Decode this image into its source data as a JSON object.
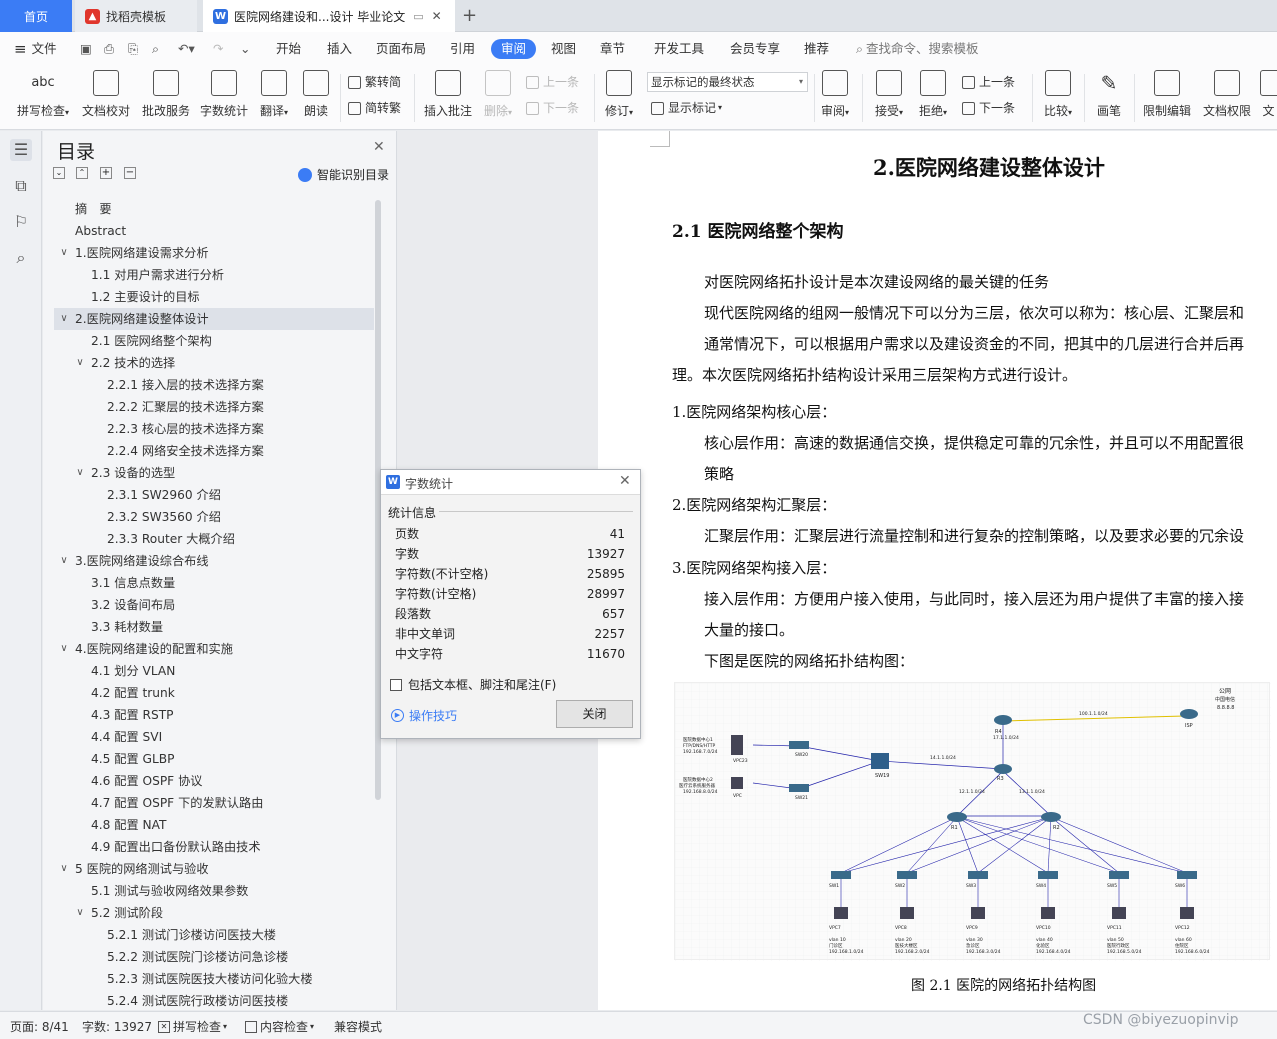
{
  "tabs": {
    "home": "首页",
    "templates": "找稻壳模板",
    "document": "医院网络建设和...设计 毕业论文"
  },
  "menu": {
    "file": "文件",
    "items": [
      "开始",
      "插入",
      "页面布局",
      "引用",
      "审阅",
      "视图",
      "章节",
      "开发工具",
      "会员专享",
      "推荐"
    ],
    "active": "审阅",
    "search_placeholder": "查找命令、搜索模板"
  },
  "ribbon": {
    "spell_check": "拼写检查",
    "doc_proof": "文档校对",
    "batch_service": "批改服务",
    "word_count": "字数统计",
    "translate": "翻译",
    "read_aloud": "朗读",
    "trad_simp": "繁转简",
    "simp_trad": "简转繁",
    "insert_comment": "插入批注",
    "delete": "删除",
    "prev1": "上一条",
    "next1": "下一条",
    "revise": "修订",
    "markup_state": "显示标记的最终状态",
    "show_markup": "显示标记",
    "review": "审阅",
    "accept": "接受",
    "reject": "拒绝",
    "prev2": "上一条",
    "next2": "下一条",
    "compare": "比较",
    "pen": "画笔",
    "restrict_edit": "限制编辑",
    "doc_permission": "文档权限",
    "doc_cut": "文"
  },
  "nav": {
    "title": "目录",
    "smart_toc": "智能识别目录",
    "items": [
      {
        "label": "摘　要",
        "level": 0,
        "chev": ""
      },
      {
        "label": "Abstract",
        "level": 0,
        "chev": ""
      },
      {
        "label": "1.医院网络建设需求分析",
        "level": 0,
        "chev": "∨"
      },
      {
        "label": "1.1 对用户需求进行分析",
        "level": 1,
        "chev": ""
      },
      {
        "label": "1.2 主要设计的目标",
        "level": 1,
        "chev": ""
      },
      {
        "label": "2.医院网络建设整体设计",
        "level": 0,
        "chev": "∨"
      },
      {
        "label": "2.1 医院网络整个架构",
        "level": 1,
        "chev": ""
      },
      {
        "label": "2.2 技术的选择",
        "level": 1,
        "chev": "∨"
      },
      {
        "label": "2.2.1  接入层的技术选择方案",
        "level": 2,
        "chev": ""
      },
      {
        "label": "2.2.2  汇聚层的技术选择方案",
        "level": 2,
        "chev": ""
      },
      {
        "label": "2.2.3  核心层的技术选择方案",
        "level": 2,
        "chev": ""
      },
      {
        "label": "2.2.4 网络安全技术选择方案",
        "level": 2,
        "chev": ""
      },
      {
        "label": "2.3 设备的选型",
        "level": 1,
        "chev": "∨"
      },
      {
        "label": "2.3.1 SW2960 介绍",
        "level": 2,
        "chev": ""
      },
      {
        "label": "2.3.2 SW3560 介绍",
        "level": 2,
        "chev": ""
      },
      {
        "label": "2.3.3 Router 大概介绍",
        "level": 2,
        "chev": ""
      },
      {
        "label": "3.医院网络建设综合布线",
        "level": 0,
        "chev": "∨"
      },
      {
        "label": "3.1  信息点数量",
        "level": 1,
        "chev": ""
      },
      {
        "label": "3.2  设备间布局",
        "level": 1,
        "chev": ""
      },
      {
        "label": "3.3  耗材数量",
        "level": 1,
        "chev": ""
      },
      {
        "label": "4.医院网络建设的配置和实施",
        "level": 0,
        "chev": "∨"
      },
      {
        "label": "4.1  划分 VLAN",
        "level": 1,
        "chev": ""
      },
      {
        "label": "4.2  配置 trunk",
        "level": 1,
        "chev": ""
      },
      {
        "label": "4.3  配置 RSTP",
        "level": 1,
        "chev": ""
      },
      {
        "label": "4.4  配置 SVI",
        "level": 1,
        "chev": ""
      },
      {
        "label": "4.5  配置 GLBP",
        "level": 1,
        "chev": ""
      },
      {
        "label": "4.6  配置 OSPF 协议",
        "level": 1,
        "chev": ""
      },
      {
        "label": "4.7 配置 OSPF 下的发默认路由",
        "level": 1,
        "chev": ""
      },
      {
        "label": "4.8 配置 NAT",
        "level": 1,
        "chev": ""
      },
      {
        "label": "4.9 配置出口备份默认路由技术",
        "level": 1,
        "chev": ""
      },
      {
        "label": "5 医院的网络测试与验收",
        "level": 0,
        "chev": "∨"
      },
      {
        "label": "5.1 测试与验收网络效果参数",
        "level": 1,
        "chev": ""
      },
      {
        "label": "5.2 测试阶段",
        "level": 1,
        "chev": "∨"
      },
      {
        "label": "5.2.1 测试门诊楼访问医技大楼",
        "level": 2,
        "chev": ""
      },
      {
        "label": "5.2.2 测试医院门诊楼访问急诊楼",
        "level": 2,
        "chev": ""
      },
      {
        "label": "5.2.3 测试医院医技大楼访问化验大楼",
        "level": 2,
        "chev": ""
      },
      {
        "label": "5.2.4 测试医院行政楼访问医技楼",
        "level": 2,
        "chev": ""
      }
    ],
    "selected_index": 5
  },
  "dialog": {
    "title": "字数统计",
    "section": "统计信息",
    "rows": [
      {
        "label": "页数",
        "value": "41"
      },
      {
        "label": "字数",
        "value": "13927"
      },
      {
        "label": "字符数(不计空格)",
        "value": "25895"
      },
      {
        "label": "字符数(计空格)",
        "value": "28997"
      },
      {
        "label": "段落数",
        "value": "657"
      },
      {
        "label": "非中文单词",
        "value": "2257"
      },
      {
        "label": "中文字符",
        "value": "11670"
      }
    ],
    "checkbox": "包括文本框、脚注和尾注(F)",
    "tips": "操作技巧",
    "close": "关闭"
  },
  "document": {
    "heading": "2.医院网络建设整体设计",
    "subheading": "2.1 医院网络整个架构",
    "lines": [
      "对医院网络拓扑设计是本次建设网络的最关键的任务",
      "现代医院网络的组网一般情况下可以分为三层，依次可以称为：核心层、汇聚层和",
      "通常情况下，可以根据用户需求以及建设资金的不同，把其中的几层进行合并后再",
      "理。本次医院网络拓扑结构设计采用三层架构方式进行设计。",
      "1.医院网络架构核心层：",
      "核心层作用：高速的数据通信交换，提供稳定可靠的冗余性，并且可以不用配置很",
      "策略",
      "2.医院网络架构汇聚层：",
      "汇聚层作用：汇聚层进行流量控制和进行复杂的控制策略，以及要求必要的冗余设",
      "3.医院网络架构接入层：",
      "接入层作用：方便用户接入使用，与此同时，接入层还为用户提供了丰富的接入接",
      "大量的接口。",
      "下图是医院的网络拓扑结构图："
    ],
    "caption": "图 2.1 医院的网络拓扑结构图",
    "diagram": {
      "isp": "ISP",
      "public": "公网",
      "telecom": "中国电信",
      "dns": "8.8.8.8",
      "link": "100.1.1.0/24",
      "r1": "R1",
      "r2": "R2",
      "r3": "R3",
      "r4": "R4",
      "sw19": "SW19",
      "sw20": "SW20",
      "sw21": "SW21",
      "dc1": "医院数据中心1",
      "dc1b": "FTP/DNS/HTTP",
      "dc1c": "192.168.7.0/24",
      "dc2": "医院数据中心2",
      "dc2b": "医疗云系统服务器",
      "dc2c": "192.168.8.0/24",
      "net1": "17.1.1.0/24",
      "net2": "14.1.1.0/24",
      "net3": "12.1.1.0/24",
      "net4": "13.1.1.0/24",
      "vpc23": "VPC23",
      "vpc": "VPC",
      "access": [
        {
          "sw": "SW1",
          "pc": "VPC7",
          "vlan": "vlan 10",
          "area": "门诊区",
          "net": "192.168.1.0/24"
        },
        {
          "sw": "SW2",
          "pc": "VPC8",
          "vlan": "vlan 20",
          "area": "医技大楼区",
          "net": "192.168.2.0/24"
        },
        {
          "sw": "SW3",
          "pc": "VPC9",
          "vlan": "vlan 30",
          "area": "急诊区",
          "net": "192.168.3.0/24"
        },
        {
          "sw": "SW4",
          "pc": "VPC10",
          "vlan": "vlan 40",
          "area": "化验区",
          "net": "192.168.4.0/24"
        },
        {
          "sw": "SW5",
          "pc": "VPC11",
          "vlan": "vlan 50",
          "area": "医院行政区",
          "net": "192.168.5.0/24"
        },
        {
          "sw": "SW6",
          "pc": "VPC12",
          "vlan": "vlan 60",
          "area": "住院区",
          "net": "192.168.6.0/24"
        }
      ]
    }
  },
  "status": {
    "page": "页面: 8/41",
    "words": "字数: 13927",
    "spell": "拼写检查",
    "content": "内容检查",
    "compat": "兼容模式",
    "watermark": "CSDN @biyezuopinvip"
  },
  "colors": {
    "accent": "#3b7cf5",
    "tab_active": "#3b7cf5"
  }
}
